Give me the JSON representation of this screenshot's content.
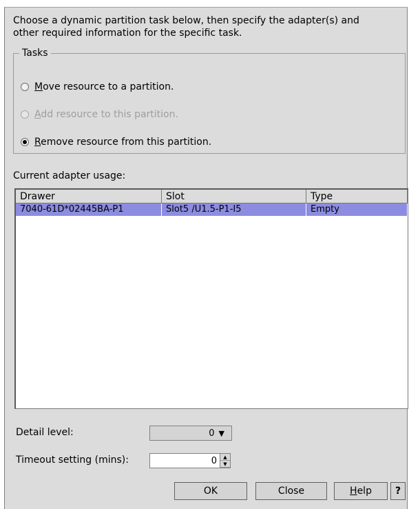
{
  "intro": {
    "line1": "Choose  a dynamic partition task below, then specify the adapter(s) and",
    "line2": "other required information for the specific task."
  },
  "tasks": {
    "legend": "Tasks",
    "options": [
      {
        "first": "M",
        "rest": "ove resource to a partition.",
        "checked": false,
        "enabled": true
      },
      {
        "first": "A",
        "rest": "dd resource to this partition.",
        "checked": false,
        "enabled": false
      },
      {
        "first": "R",
        "rest": "emove resource from this partition.",
        "checked": true,
        "enabled": true
      }
    ]
  },
  "usage_label": "Current adapter usage:",
  "table": {
    "columns": [
      "Drawer",
      "Slot",
      "Type"
    ],
    "rows": [
      {
        "drawer": "7040-61D*02445BA-P1",
        "slot": "Slot5 /U1.5-P1-I5",
        "type": "Empty"
      }
    ],
    "selected_color": "#8c8ce0"
  },
  "detail": {
    "label": "Detail level:",
    "value": "0",
    "arrow_icon": "caret-down-icon"
  },
  "timeout": {
    "label": "Timeout setting (mins):",
    "value": "0"
  },
  "buttons": {
    "ok": "OK",
    "close": "Close",
    "help_first": "H",
    "help_rest": "elp",
    "question": "?"
  }
}
